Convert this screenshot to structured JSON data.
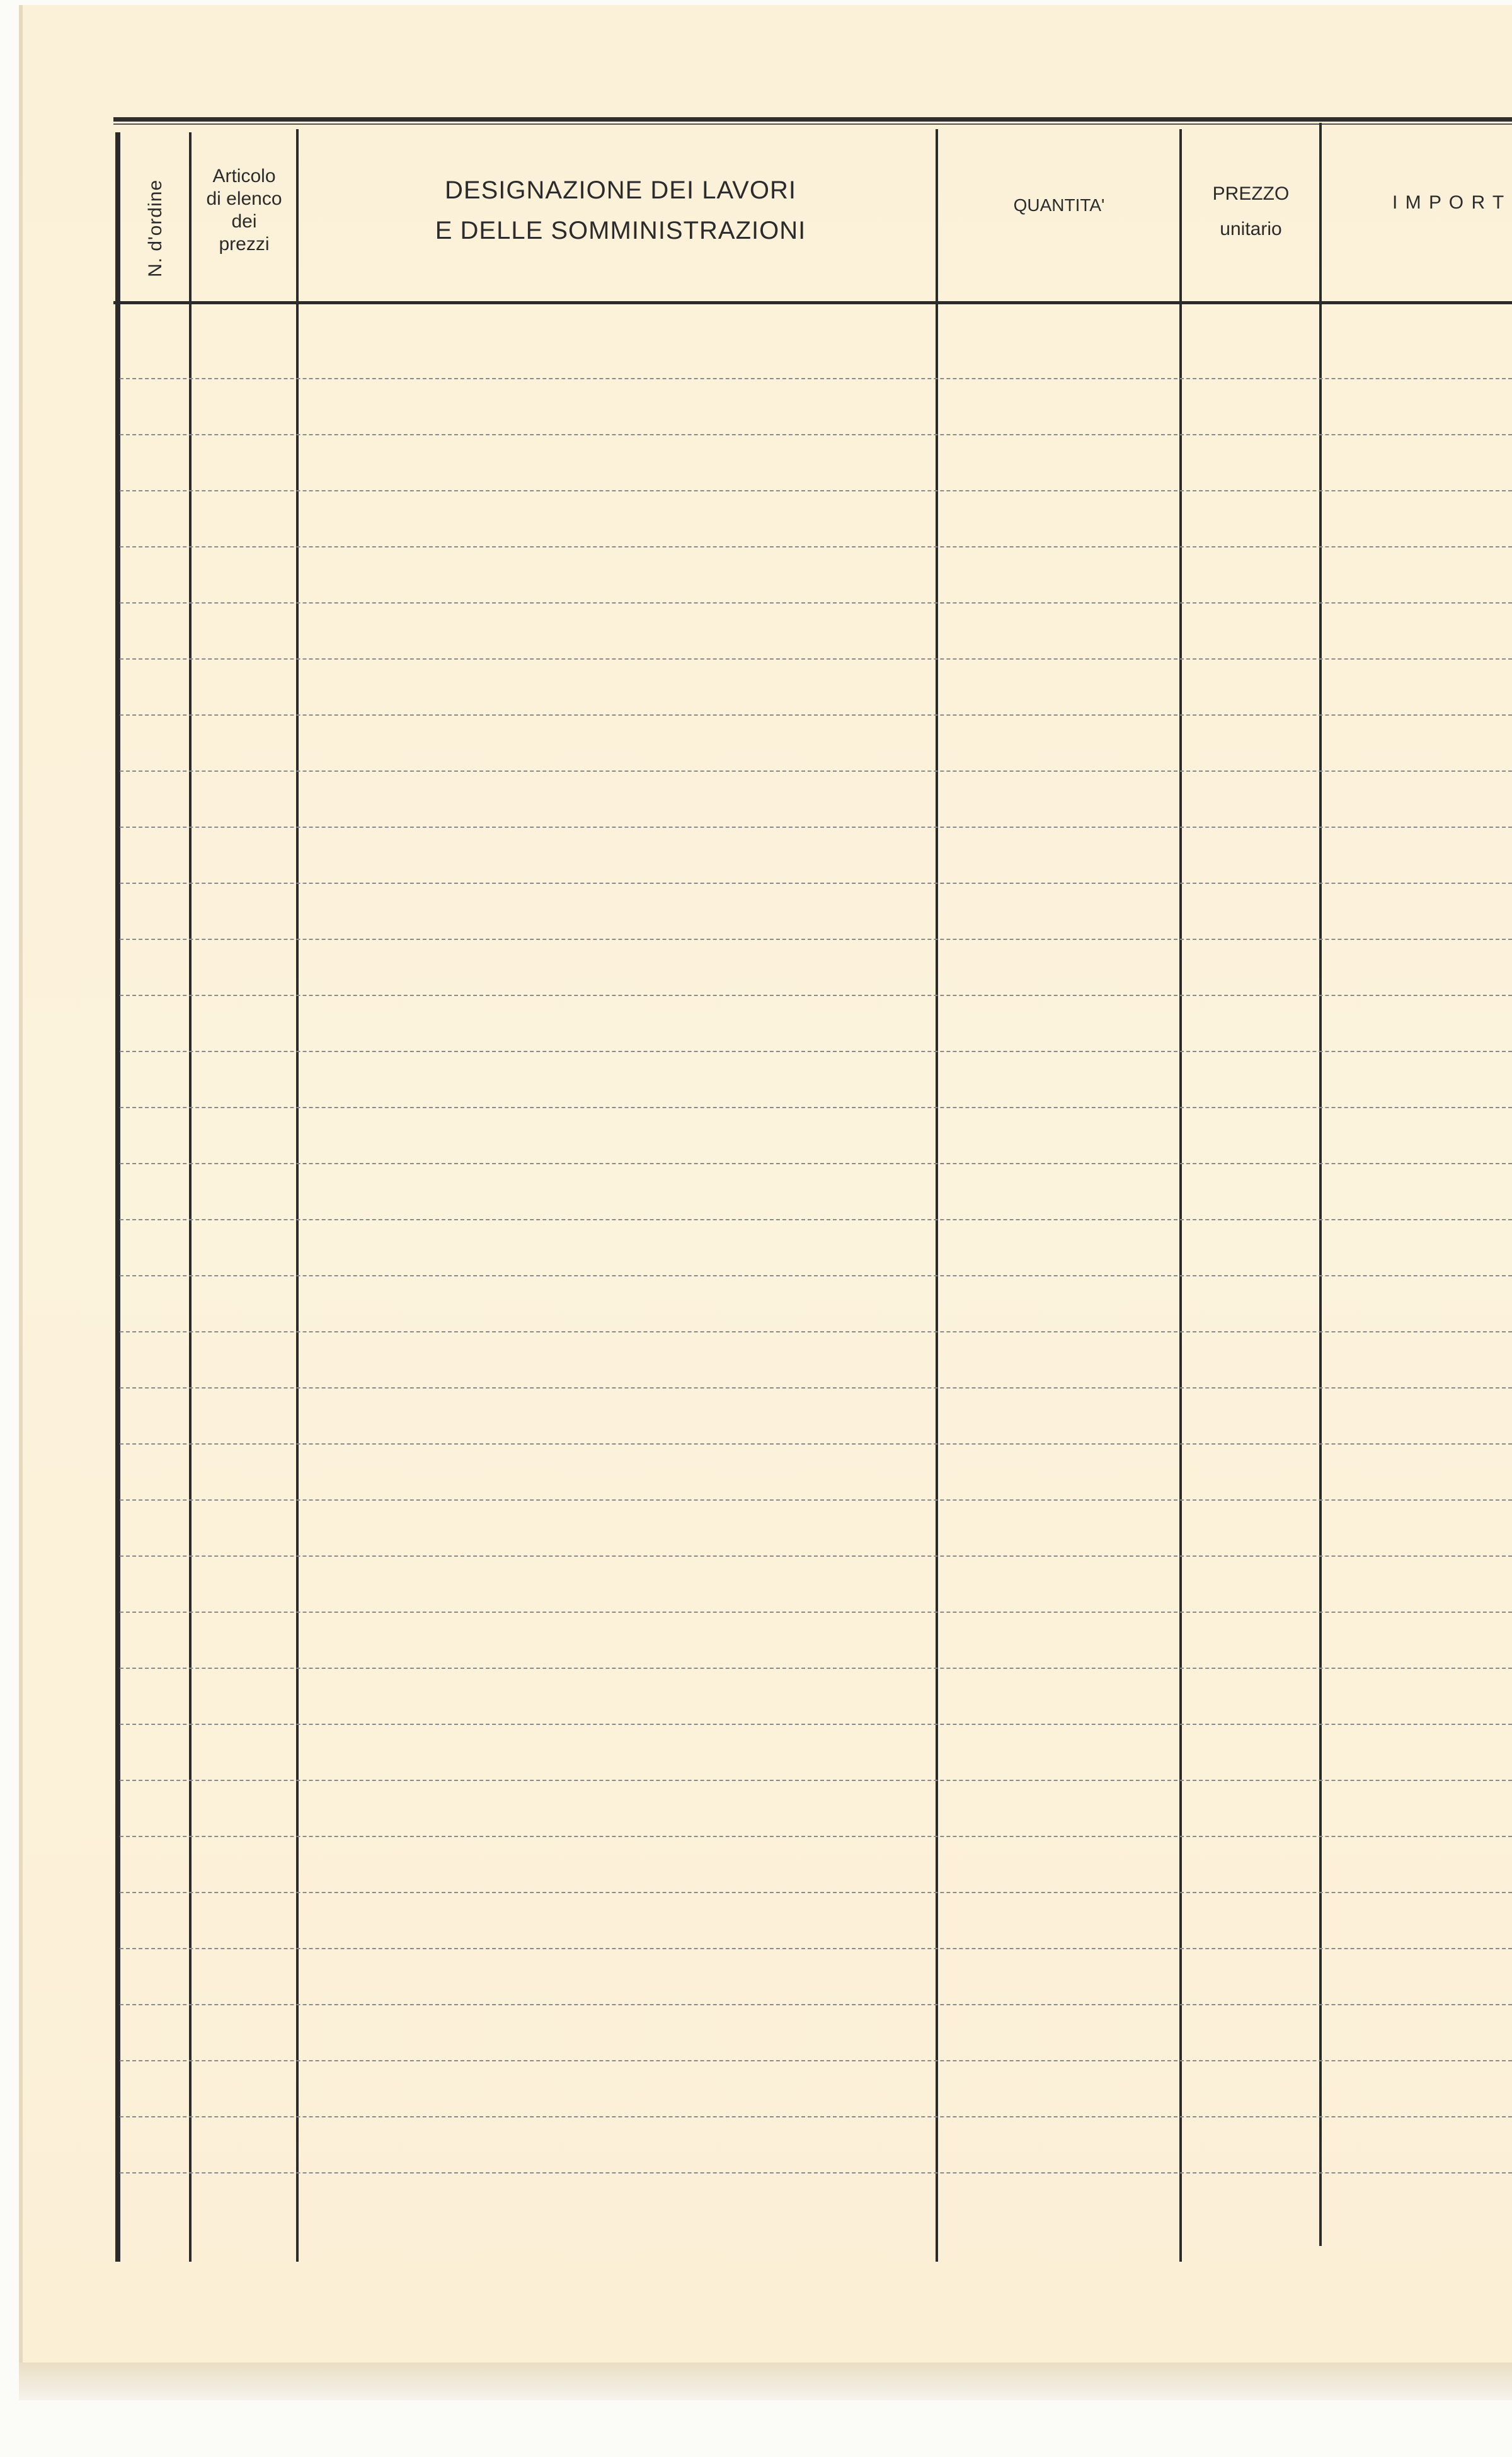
{
  "table_header": {
    "order_number_label": "N. d'ordine",
    "article_label": [
      "Articolo",
      "di elenco",
      "dei",
      "prezzi"
    ],
    "designation_label": [
      "DESIGNAZIONE DEI LAVORI",
      "E DELLE SOMMINISTRAZIONI"
    ],
    "quantity_label": "QUANTITA'",
    "price_label": [
      "PREZZO",
      "unitario"
    ],
    "amount_label": "I M P O R T O"
  },
  "table_body": {
    "row_count": 33
  },
  "colors": {
    "paper": "#fcf3dc",
    "ink": "#2b2b2b",
    "dash": "#8a8a8a"
  }
}
